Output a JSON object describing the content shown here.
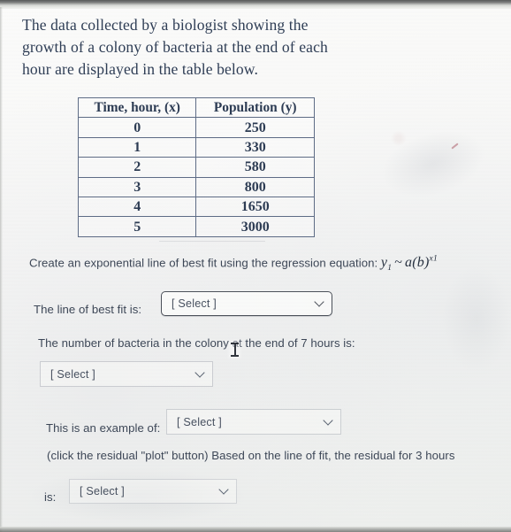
{
  "headline": "The data collected by a biologist showing the growth of a colony of bacteria at the end of each hour are displayed in the table below.",
  "table": {
    "headers": [
      "Time, hour, (x)",
      "Population (y)"
    ],
    "rows": [
      [
        "0",
        "250"
      ],
      [
        "1",
        "330"
      ],
      [
        "2",
        "580"
      ],
      [
        "3",
        "800"
      ],
      [
        "4",
        "1650"
      ],
      [
        "5",
        "3000"
      ]
    ]
  },
  "questions": {
    "regression_prefix": "Create an exponential line of best fit using the regression equation:",
    "regression_equation": {
      "y": "y",
      "y_sub": "1",
      "tilde": "~",
      "a": "a",
      "open_paren": "(",
      "b": "b",
      "close_paren": ")",
      "exp_x": "x",
      "exp_sub": "1"
    },
    "best_fit_label": "The line of best fit is:",
    "bacteria_7_label": "The number of bacteria in the colony at the end of 7 hours is:",
    "example_of_label": "This is an example of:",
    "residual_note": "(click the residual \"plot\" button) Based on the line of fit, the residual for 3 hours",
    "residual_is_label": "is:"
  },
  "dropdowns": {
    "best_fit": "[ Select ]",
    "bacteria_7": "[ Select ]",
    "example_of": "[ Select ]",
    "residual": "[ Select ]"
  },
  "colors": {
    "heading_text": "#2d3c54",
    "body_text": "#3c4656",
    "table_border": "#5d6b85",
    "select_border_strong": "#4a4f58",
    "select_text": "#47505f"
  }
}
